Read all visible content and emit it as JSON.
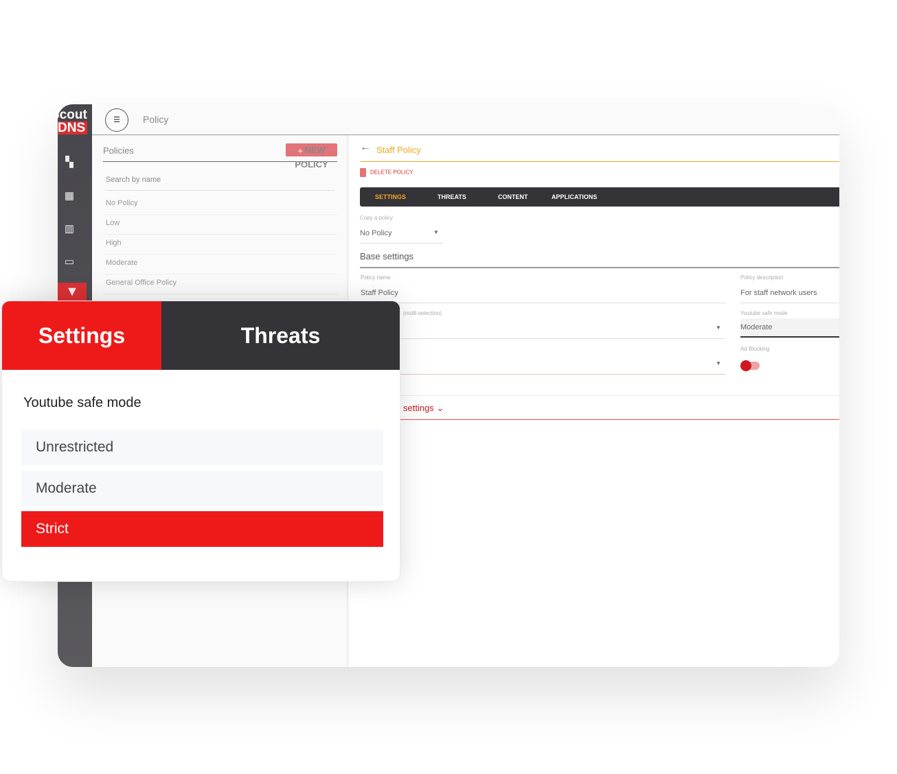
{
  "app": {
    "logo_top": "Scout",
    "logo_bottom": "DNS",
    "page_title": "Policy"
  },
  "sidebar": {
    "icons": [
      "dashboard-icon",
      "reports-icon",
      "building-icon",
      "devices-icon",
      "filter-icon"
    ],
    "active": "filter-icon"
  },
  "policies": {
    "title": "Policies",
    "new_button": "NEW POLICY",
    "search_placeholder": "Search by name",
    "items": [
      "No Policy",
      "Low",
      "High",
      "Moderate",
      "General Office Policy"
    ]
  },
  "detail": {
    "title": "Staff Policy",
    "delete_label": "DELETE POLICY",
    "tabs": [
      "SETTINGS",
      "THREATS",
      "CONTENT",
      "APPLICATIONS"
    ],
    "active_tab": "SETTINGS",
    "copy_label": "Copy a policy",
    "copy_value": "No Policy",
    "base_settings": "Base settings",
    "name_label": "Policy name",
    "name_value": "Staff Policy",
    "desc_label": "Policy description",
    "desc_value": "For staff network users",
    "multi_label": "(multi selection)",
    "yt_label": "Youtube safe mode",
    "yt_value": "Moderate",
    "ad_label": "Ad Blocking",
    "ad_blocking_on": true,
    "more_settings": "settings"
  },
  "overlay": {
    "tabs": [
      "Settings",
      "Threats"
    ],
    "active_tab": "Settings",
    "heading": "Youtube safe mode",
    "options": [
      "Unrestricted",
      "Moderate",
      "Strict"
    ],
    "selected": "Strict"
  },
  "colors": {
    "accent": "#ee1a1a",
    "title": "#f5a623",
    "dark": "#333338"
  }
}
